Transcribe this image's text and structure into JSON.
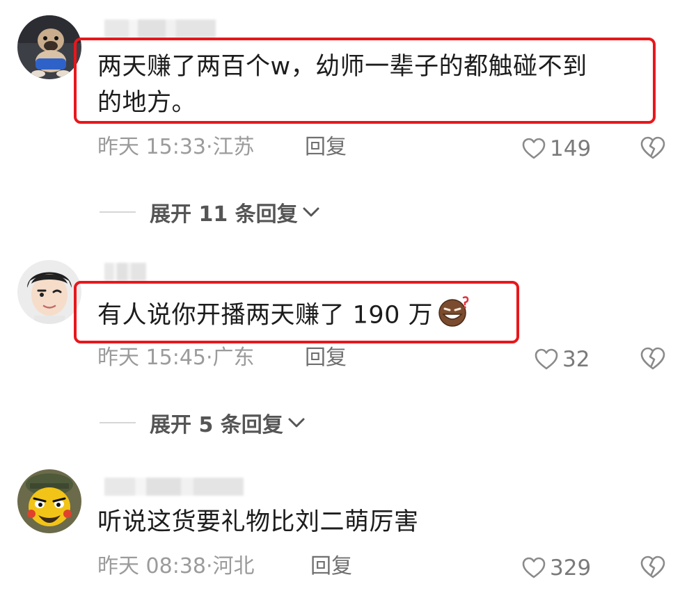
{
  "colors": {
    "highlight": "#e8171c",
    "meta": "#9b9b9b",
    "text": "#1c1c1c"
  },
  "comments": [
    {
      "text_line1": "两天赚了两百个w，幼师一辈子的都触碰不到",
      "text_line2": "的地方。",
      "time": "昨天 15:33",
      "location": "江苏",
      "reply": "回复",
      "likes": "149",
      "expand": "展开 11 条回复",
      "avatar": "dog-avatar"
    },
    {
      "text_line1": "有人说你开播两天赚了 190 万",
      "time": "昨天 15:45",
      "location": "广东",
      "reply": "回复",
      "likes": "32",
      "expand": "展开 5 条回复",
      "avatar": "cartoon-man-avatar",
      "emoji": "grinning-emoji"
    },
    {
      "text_line1": "听说这货要礼物比刘二萌厉害",
      "time": "昨天 08:38",
      "location": "河北",
      "reply": "回复",
      "likes": "329",
      "avatar": "cartoon-soldier-avatar"
    }
  ]
}
